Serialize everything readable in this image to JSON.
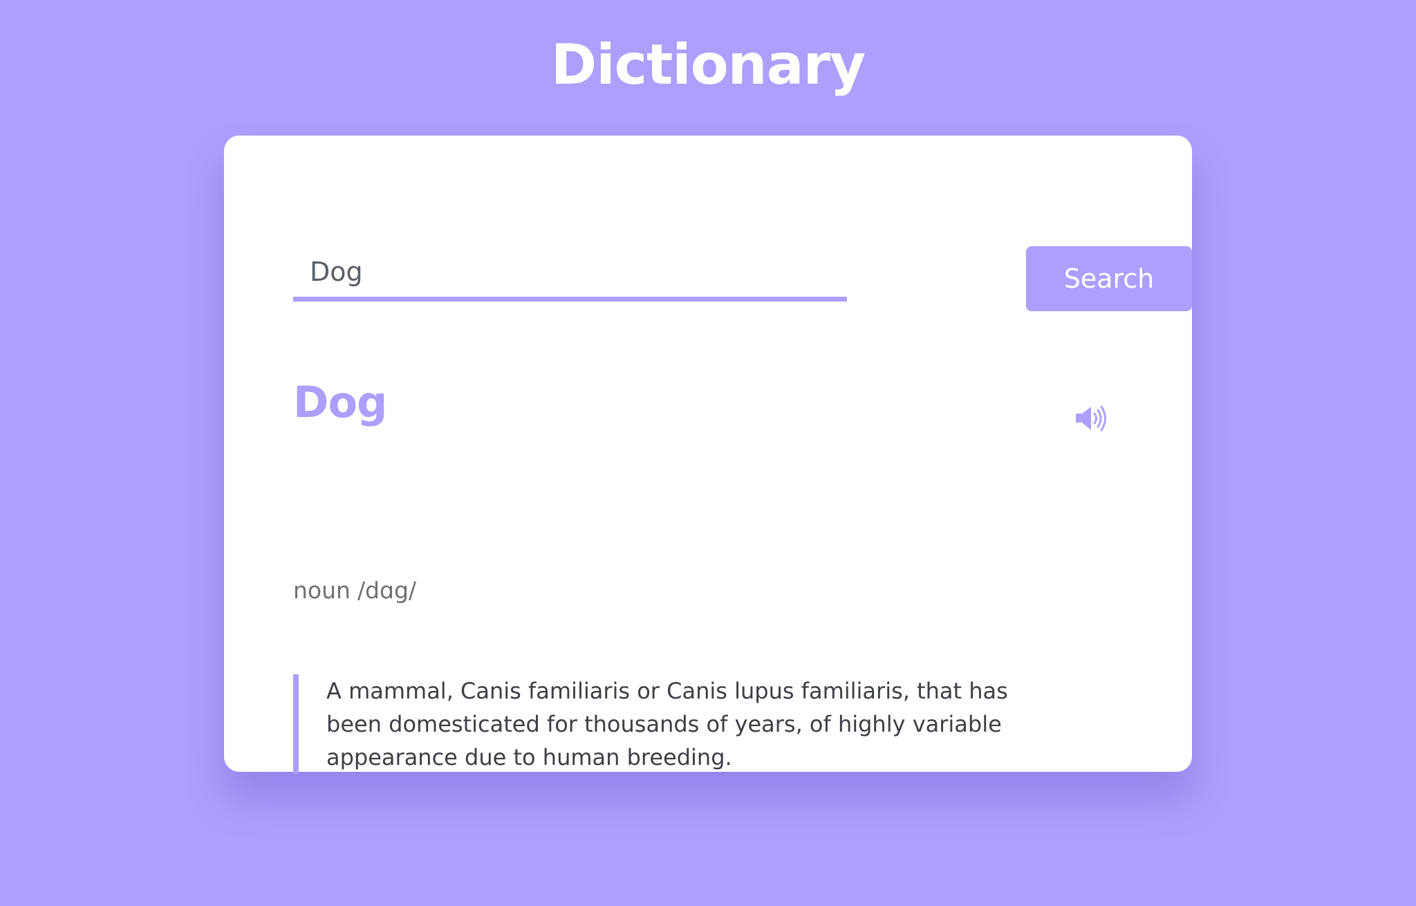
{
  "app": {
    "title": "Dictionary"
  },
  "search": {
    "value": "Dog",
    "placeholder": "",
    "button_label": "Search"
  },
  "result": {
    "word": "Dog",
    "part_of_speech": "noun",
    "phonetic": "/dɑg/",
    "definition": "A mammal, Canis familiaris or Canis lupus familiaris, that has been domesticated for thousands of years, of highly variable appearance due to human breeding."
  },
  "icons": {
    "sound": "volume-up-icon"
  },
  "colors": {
    "background": "#ae9efe",
    "accent": "#ae9efe",
    "card": "#ffffff",
    "text": "#3c3f45"
  }
}
